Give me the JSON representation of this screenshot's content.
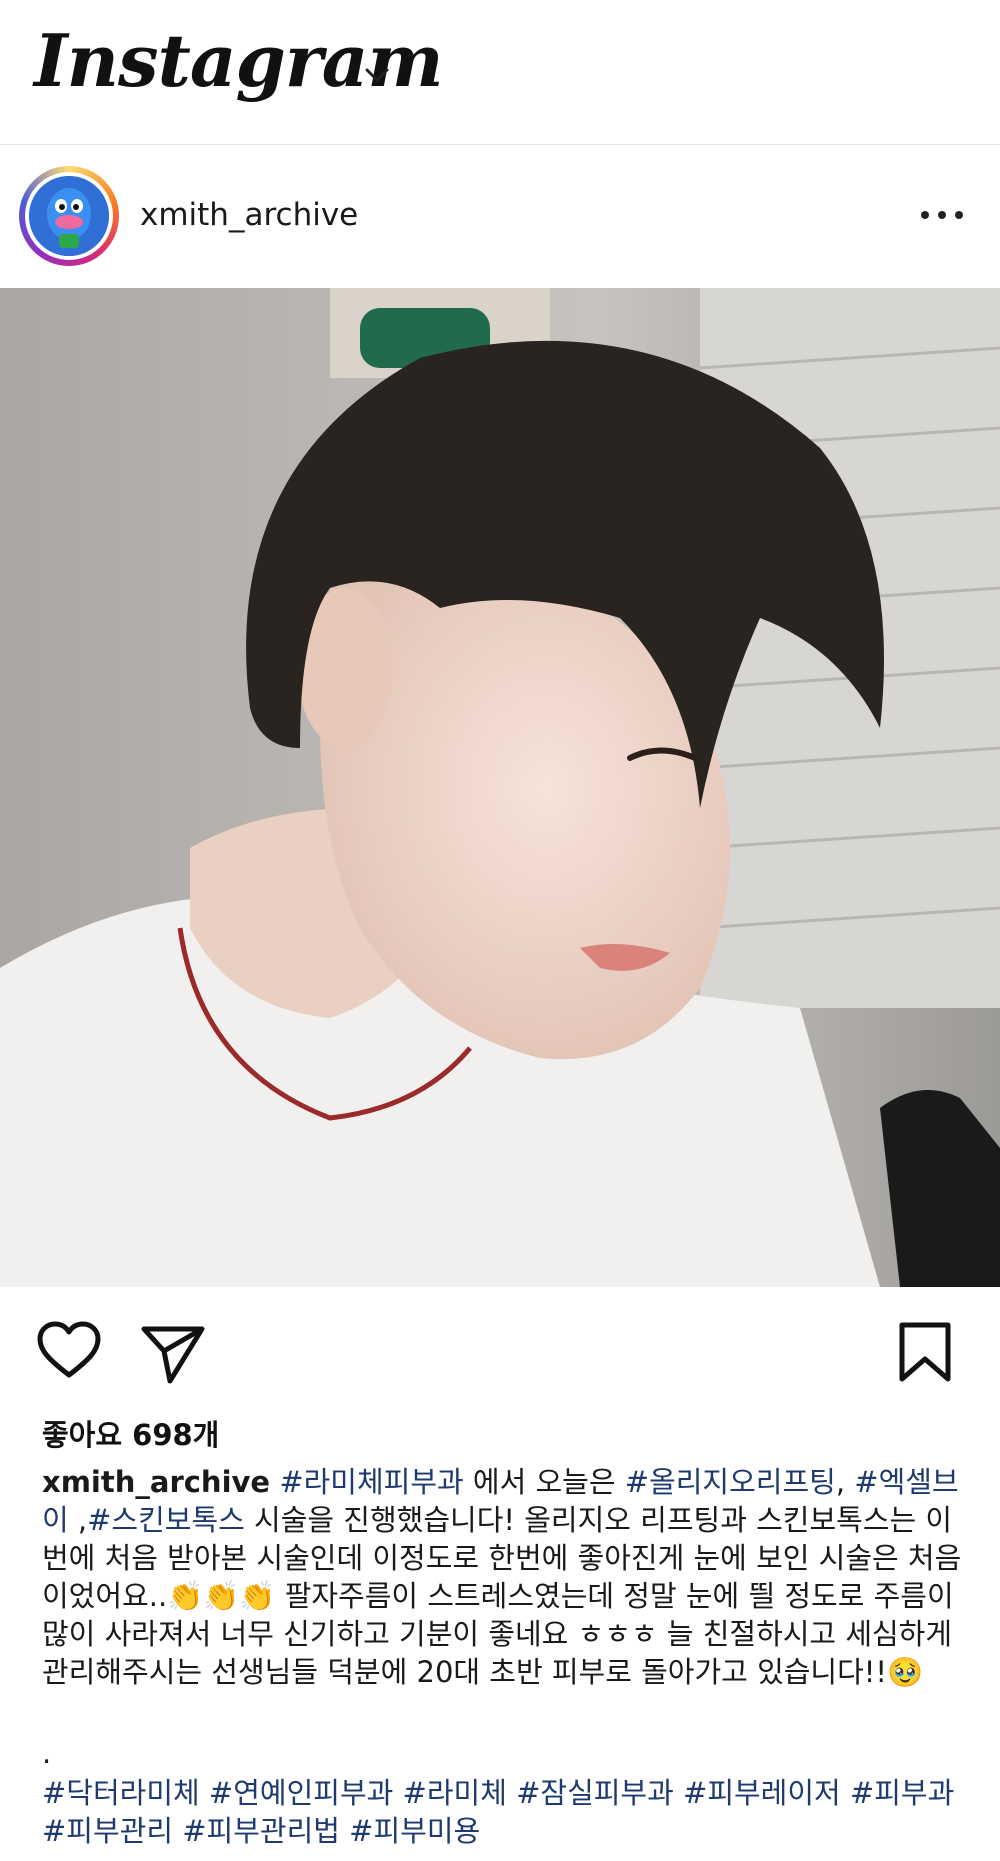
{
  "app": {
    "name": "Instagram"
  },
  "post": {
    "username": "xmith_archive",
    "likes_text": "좋아요 698개",
    "caption": {
      "username": "xmith_archive",
      "segments": [
        {
          "type": "tag",
          "text": "#라미체피부과"
        },
        {
          "type": "text",
          "text": " 에서 오늘은 "
        },
        {
          "type": "tag",
          "text": "#올리지오리프팅"
        },
        {
          "type": "text",
          "text": ", "
        },
        {
          "type": "tag",
          "text": "#엑셀브이"
        },
        {
          "type": "text",
          "text": " ,"
        },
        {
          "type": "tag",
          "text": "#스킨보톡스"
        },
        {
          "type": "text",
          "text": " 시술을 진행했습니다! 올리지오 리프팅과 스킨보톡스는 이번에 처음 받아본 시술인데 이정도로 한번에 좋아진게 눈에 보인 시술은 처음이었어요..👏👏👏 팔자주름이 스트레스였는데 정말 눈에 띌 정도로 주름이 많이 사라져서 너무 신기하고 기분이 좋네요 ㅎㅎㅎ 늘 친절하시고 세심하게 관리해주시는 선생님들 덕분에 20대 초반 피부로 돌아가고 있습니다!!🥹"
        }
      ],
      "separator": ".",
      "hashtags": [
        "#닥터라미체",
        "#연예인피부과",
        "#라미체",
        "#잠실피부과",
        "#피부레이저",
        "#피부과",
        "#피부관리",
        "#피부관리법",
        "#피부미용"
      ]
    }
  },
  "icons": {
    "menu": "chevron-down-icon",
    "more": "more-horizontal-icon",
    "like": "heart-icon",
    "share": "send-icon",
    "save": "bookmark-icon"
  },
  "colors": {
    "hashtag": "#1f3a6e",
    "text": "#1a1a1a"
  }
}
